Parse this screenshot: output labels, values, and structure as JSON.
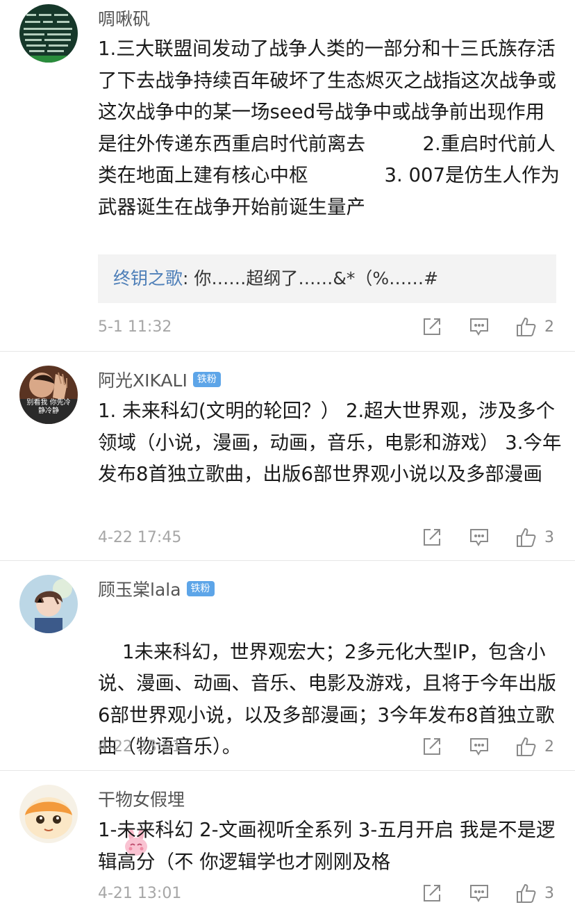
{
  "comments": [
    {
      "username": "啁啾矾",
      "text": "1.三大联盟间发动了战争人类的一部分和十三氏族存活了下去战争持续百年破坏了生态烬灭之战指这次战争或这次战争中的某一场seed号战争中或战争前出现作用是往外传递东西重启时代前离去　　　2.重启时代前人类在地面上建有核心中枢　　　　3. 007是仿生人作为武器诞生在战争开始前诞生量产",
      "reply": {
        "user": "终钥之歌",
        "sep": ": ",
        "text": "你……超纲了……&*（%……#"
      },
      "time": "5-1 11:32",
      "likes": "2"
    },
    {
      "username": "阿光XIKALI",
      "badge": "铁粉",
      "avatar_caption": "别看我 你先冷静冷静",
      "text": "1. 未来科幻(文明的轮回？） 2.超大世界观，涉及多个领域（小说，漫画，动画，音乐，电影和游戏） 3.今年发布8首独立歌曲，出版6部世界观小说以及多部漫画",
      "time": "4-22 17:45",
      "likes": "3"
    },
    {
      "username": "顾玉棠lala",
      "badge": "铁粉",
      "text": "1未来科幻，世界观宏大；2多元化大型IP，包含小说、漫画、动画、音乐、电影及游戏，且将于今年出版6部世界观小说，以及多部漫画；3今年发布8首独立歌曲（物语音乐）。",
      "time": "4-22 23:51",
      "likes": "2"
    },
    {
      "username": "干物女假埋",
      "text": "1-未来科幻 2-文画视听全系列 3-五月开启 我是不是逻辑高分（不 你逻辑学也才刚刚及格",
      "time": "4-21 13:01",
      "likes": "3"
    }
  ],
  "icons": {
    "share": "share-icon",
    "reply": "comment-icon",
    "like": "thumbs-up-icon",
    "emoji": "pink-bunny-emoji-icon"
  },
  "colors": {
    "reply_user": "#4e7fb8",
    "badge": "#5da5e8",
    "meta": "#a6a6a6"
  }
}
